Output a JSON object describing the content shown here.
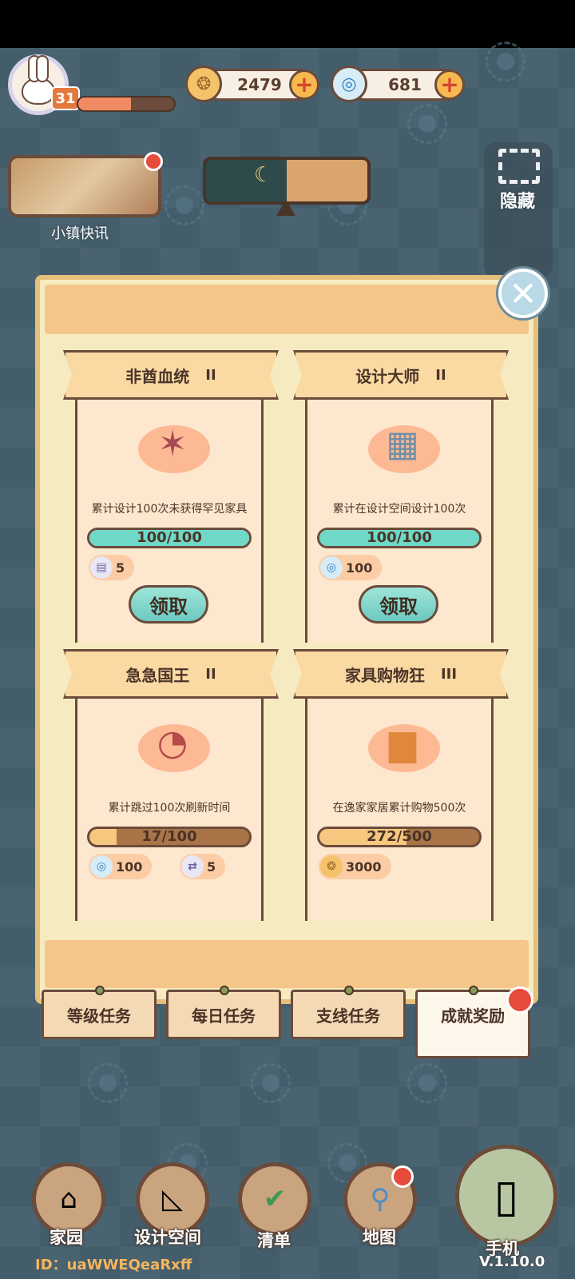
{
  "hud": {
    "level": "31",
    "xp_progress": 0.55,
    "coins": "2479",
    "swirls": "681",
    "news_label": "小镇快讯",
    "hide_label": "隐藏"
  },
  "modal": {
    "cards": [
      {
        "title": "非酋血统",
        "tier": "II",
        "icon": "feather-headdress-icon",
        "desc": "累计设计100次未获得罕见家具",
        "progress_text": "100/100",
        "progress": 1.0,
        "rewards": [
          {
            "icon": "blueprint-ticket-icon",
            "value": "5"
          }
        ],
        "claim_label": "领取"
      },
      {
        "title": "设计大师",
        "tier": "II",
        "icon": "blueprint-scroll-icon",
        "desc": "累计在设计空间设计100次",
        "progress_text": "100/100",
        "progress": 1.0,
        "rewards": [
          {
            "icon": "blue-swirl-icon",
            "value": "100"
          }
        ],
        "claim_label": "领取"
      },
      {
        "title": "急急国王",
        "tier": "II",
        "icon": "skip-clock-icon",
        "desc": "累计跳过100次刷新时间",
        "progress_text": "17/100",
        "progress": 0.17,
        "rewards": [
          {
            "icon": "blue-swirl-icon",
            "value": "100"
          },
          {
            "icon": "refresh-ticket-icon",
            "value": "5"
          }
        ]
      },
      {
        "title": "家具购物狂",
        "tier": "III",
        "icon": "armchair-icon",
        "desc": "在逸家家居累计购物500次",
        "progress_text": "272/500",
        "progress": 0.544,
        "rewards": [
          {
            "icon": "coin-icon",
            "value": "3000"
          }
        ]
      }
    ]
  },
  "tabs": [
    {
      "label": "等级任务"
    },
    {
      "label": "每日任务"
    },
    {
      "label": "支线任务"
    },
    {
      "label": "成就奖励"
    }
  ],
  "bottom_nav": [
    {
      "label": "家园"
    },
    {
      "label": "设计空间"
    },
    {
      "label": "清单"
    },
    {
      "label": "地图"
    },
    {
      "label": "手机"
    }
  ],
  "footer": {
    "id": "ID：uaWWEQeaRxff",
    "version": "V.1.10.0"
  },
  "colors": {
    "claimable_bar": "#6fd8c6",
    "partial_bar": "#f5c77f",
    "background": "#435d6b"
  }
}
